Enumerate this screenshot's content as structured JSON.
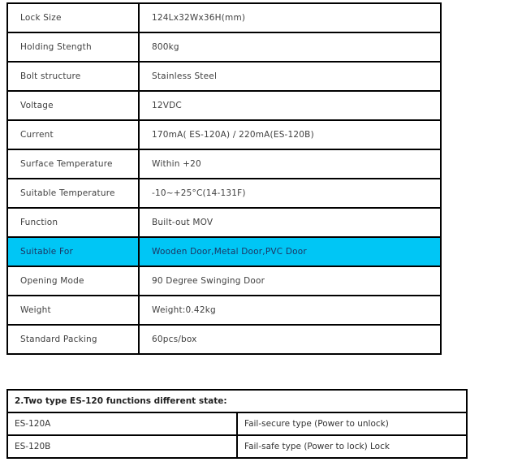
{
  "spec_table": {
    "rows": [
      {
        "label": "Lock Size",
        "value": "124Lx32Wx36H(mm)"
      },
      {
        "label": "Holding Stength",
        "value": "800kg"
      },
      {
        "label": "Bolt structure",
        "value": "Stainless Steel"
      },
      {
        "label": "Voltage",
        "value": "12VDC"
      },
      {
        "label": "Current",
        "value": "170mA( ES-120A) / 220mA(ES-120B)"
      },
      {
        "label": "Surface Temperature",
        "value": "Within +20"
      },
      {
        "label": "Suitable Temperature",
        "value": "-10~+25°C(14-131F)"
      },
      {
        "label": "Function",
        "value": "Built-out MOV"
      },
      {
        "label": "Suitable For",
        "value": "Wooden Door,Metal Door,PVC Door",
        "highlighted": true
      },
      {
        "label": "Opening Mode",
        "value": "90 Degree Swinging Door"
      },
      {
        "label": "Weight",
        "value": "Weight:0.42kg"
      },
      {
        "label": "Standard Packing",
        "value": "60pcs/box"
      }
    ],
    "highlight_color": "#00c6f5"
  },
  "state_table": {
    "title": "2.Two type ES-120 functions different state:",
    "rows": [
      {
        "model": "ES-120A",
        "description": "Fail-secure type (Power to unlock)"
      },
      {
        "model": "ES-120B",
        "description": "Fail-safe type (Power to lock) Lock"
      }
    ]
  }
}
